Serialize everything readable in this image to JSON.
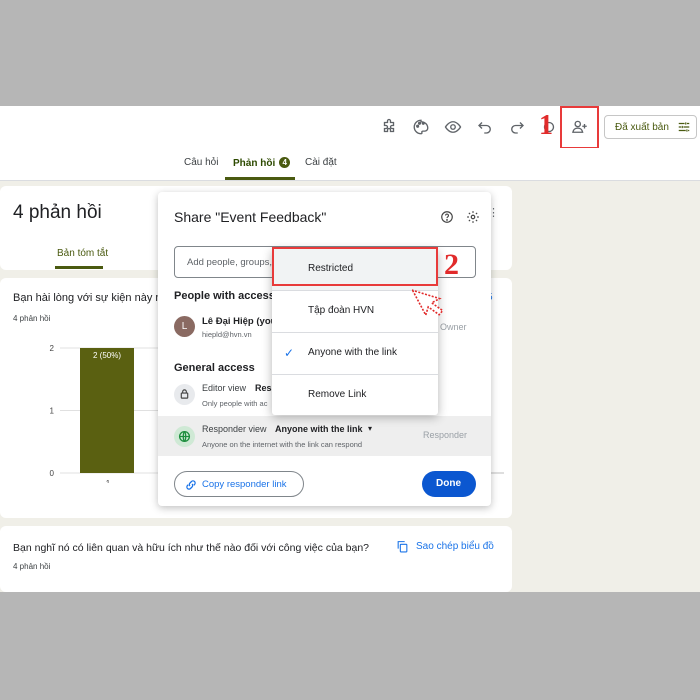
{
  "toolbar": {
    "icons": [
      "puzzle-icon",
      "palette-icon",
      "eye-icon",
      "undo-icon",
      "redo-icon",
      "link-icon",
      "add-person-icon",
      "settings-icon"
    ],
    "publish_label": "Đã xuất bản"
  },
  "tabs": [
    {
      "label": "Câu hỏi"
    },
    {
      "label": "Phản hồi",
      "badge": "4"
    },
    {
      "label": "Cài đặt"
    }
  ],
  "responses": {
    "title": "4 phản hồi",
    "summary_tab": "Bản tóm tắt"
  },
  "question1": {
    "text": "Bạn hài lòng với sự kiện này n",
    "count": "4 phản hồi",
    "copy_mark": "5"
  },
  "chart_data": {
    "type": "bar",
    "categories": [
      "1"
    ],
    "values": [
      2
    ],
    "ylim": [
      0,
      2
    ],
    "yticks": [
      "2",
      "1",
      "0"
    ],
    "data_labels": [
      "2 (50%)"
    ],
    "color": "#5a6011"
  },
  "question2": {
    "text": "Bạn nghĩ nó có liên quan và hữu ích như thế nào đối với công việc của bạn?",
    "count": "4 phản hồi",
    "copy_label": "Sao chép biểu đồ"
  },
  "share": {
    "title": "Share \"Event Feedback\"",
    "input_placeholder": "Add people, groups,",
    "people_heading": "People with access",
    "person": {
      "initial": "L",
      "name": "Lê Đại Hiệp (you",
      "email": "hiepld@hvn.vn",
      "role": "Owner"
    },
    "general_heading": "General access",
    "editor": {
      "label": "Editor view",
      "value": "Res",
      "sub": "Only people with ac"
    },
    "responder": {
      "label": "Responder view",
      "value": "Anyone with the link",
      "sub": "Anyone on the internet with the link can respond",
      "role": "Responder"
    },
    "copy_link_label": "Copy responder link",
    "done_label": "Done"
  },
  "menu": {
    "items": [
      {
        "label": "Restricted",
        "checked": false
      },
      {
        "label": "Tập đoàn HVN",
        "checked": false
      },
      {
        "label": "Anyone with the link",
        "checked": true
      },
      {
        "label": "Remove Link",
        "checked": false
      }
    ]
  },
  "annotations": {
    "step1": "1",
    "step2": "2"
  },
  "colors": {
    "accent": "#1a73e8",
    "brand": "#4a5a10",
    "annotation": "#e12b2b"
  }
}
